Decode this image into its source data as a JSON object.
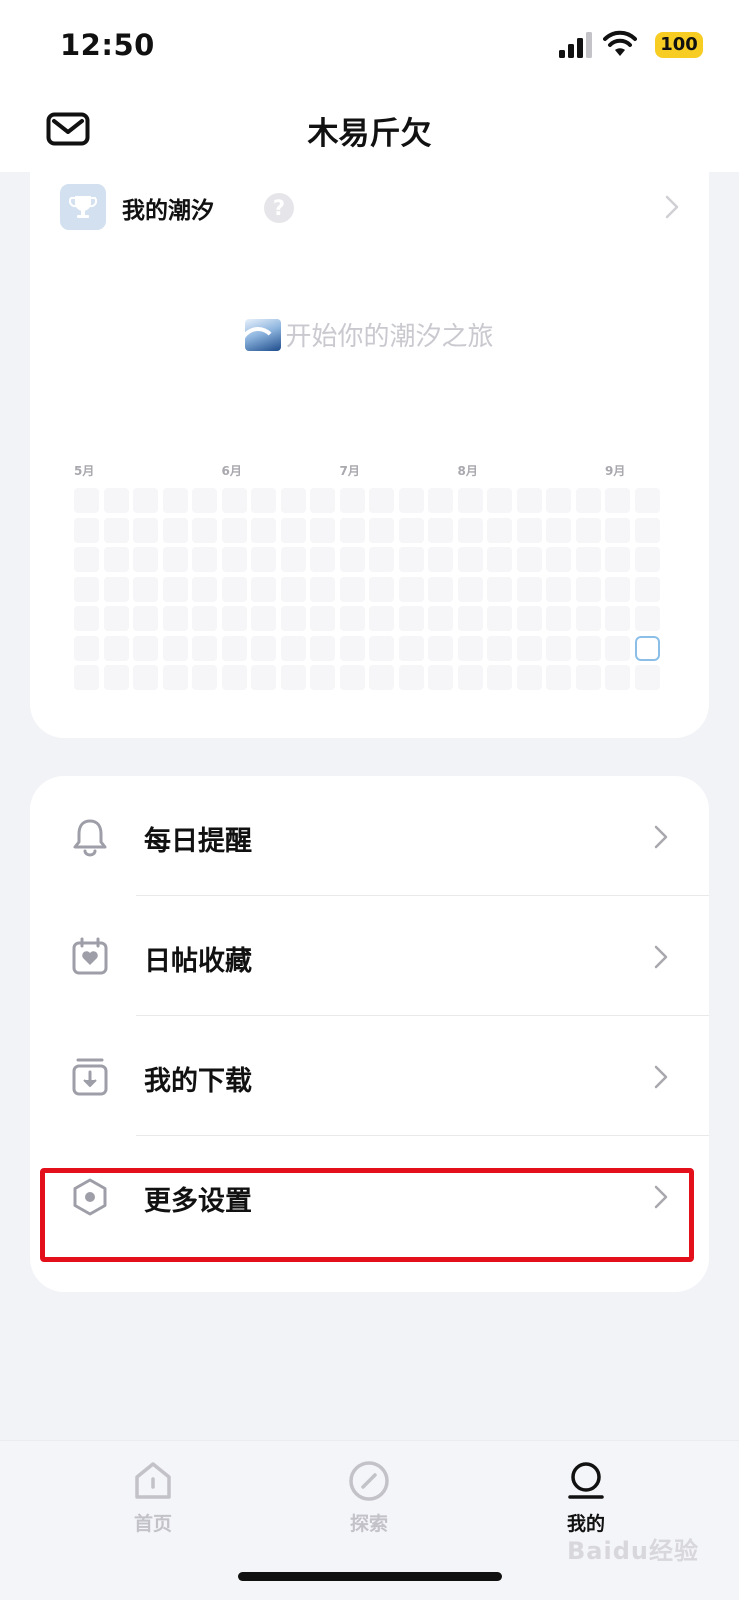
{
  "status_bar": {
    "time": "12:50",
    "battery": "100"
  },
  "header": {
    "title": "木易斤欠",
    "mail_icon": "mail-icon"
  },
  "tide": {
    "title": "我的潮汐",
    "help": "?",
    "empty_text": "开始你的潮汐之旅",
    "wave_icon": "wave-icon",
    "months": [
      {
        "label": "5月",
        "col": 0
      },
      {
        "label": "6月",
        "col": 5
      },
      {
        "label": "7月",
        "col": 9
      },
      {
        "label": "8月",
        "col": 13
      },
      {
        "label": "9月",
        "col": 18
      }
    ],
    "grid": {
      "rows": 7,
      "cols": 20,
      "today": {
        "row": 5,
        "col": 19
      }
    }
  },
  "menu": {
    "items": [
      {
        "label": "每日提醒",
        "icon": "bell-icon"
      },
      {
        "label": "日帖收藏",
        "icon": "calendar-heart-icon"
      },
      {
        "label": "我的下载",
        "icon": "download-icon"
      },
      {
        "label": "更多设置",
        "icon": "settings-hexagon-icon"
      }
    ],
    "highlighted": "更多设置"
  },
  "tabs": [
    {
      "label": "首页",
      "icon": "home-icon",
      "active": false
    },
    {
      "label": "探索",
      "icon": "compass-icon",
      "active": false
    },
    {
      "label": "我的",
      "icon": "profile-icon",
      "active": true
    }
  ],
  "watermark": "Baidu经验",
  "colors": {
    "accent_today": "#8bbfe8",
    "highlight": "#e3101c",
    "battery": "#f7cd24"
  }
}
